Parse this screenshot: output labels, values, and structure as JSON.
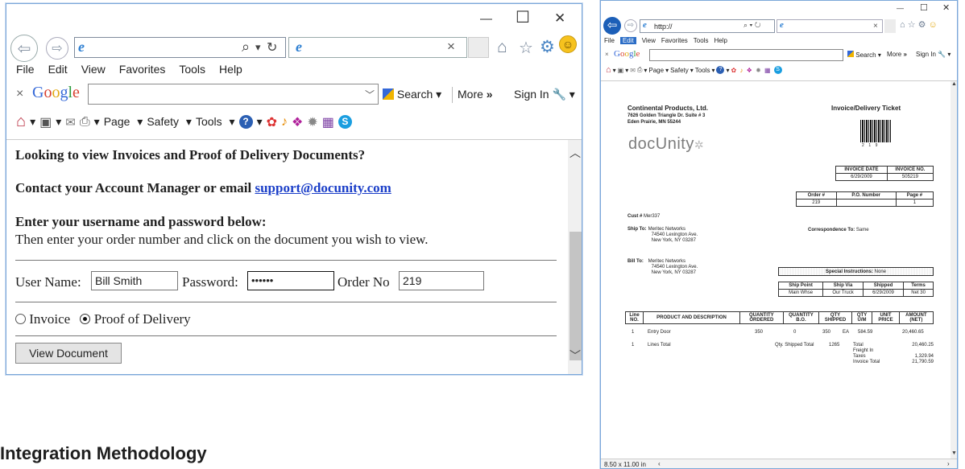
{
  "heading": "Integration Methodology",
  "left_window": {
    "window_controls": {
      "minimize": "—",
      "maximize": "☐",
      "close": "✕"
    },
    "address": {
      "icon": "ie-logo-icon",
      "value": "",
      "search_glyph": "⌕",
      "dropdown": "▾",
      "refresh": "↻"
    },
    "tab_close": "×",
    "menu": [
      "File",
      "Edit",
      "View",
      "Favorites",
      "Tools",
      "Help"
    ],
    "google_bar": {
      "close": "×",
      "logo": [
        "G",
        "o",
        "o",
        "g",
        "l",
        "e"
      ],
      "search_label": "Search",
      "more_label": "More",
      "more_chevrons": "»",
      "signin_label": "Sign In"
    },
    "command_bar": {
      "page_label": "Page",
      "safety_label": "Safety",
      "tools_label": "Tools"
    },
    "content": {
      "line1": "Looking to view Invoices and Proof of Delivery Documents?",
      "line2_text": "Contact your Account Manager or email ",
      "line2_link": "support@docunity.com",
      "line3": "Enter your username and password below:",
      "line4": "Then enter your order number and click on the document you wish to view.",
      "username_label": "User Name:",
      "username_value": "Bill Smith",
      "password_label": "Password:",
      "password_value": "••••••",
      "order_label": "Order No",
      "order_value": "219",
      "radio_invoice": "Invoice",
      "radio_pod": "Proof of Delivery",
      "view_button": "View Document"
    }
  },
  "right_window": {
    "window_controls": {
      "minimize": "—",
      "maximize": "☐",
      "close": "✕"
    },
    "address_value": "http://",
    "menu": [
      "File",
      "Edit",
      "View",
      "Favorites",
      "Tools",
      "Help"
    ],
    "google_bar": {
      "search_label": "Search",
      "more_label": "More",
      "signin_label": "Sign In"
    },
    "command_bar": {
      "page_label": "Page",
      "safety_label": "Safety",
      "tools_label": "Tools"
    },
    "status_size": "8.50 x 11.00 in",
    "invoice": {
      "company": "Continental Products, Ltd.",
      "address1": "7626 Golden Triangle Dr. Suite # 3",
      "address2": "Eden Prairie, MN 55244",
      "title": "Invoice/Delivery Ticket",
      "barcode_caption": "2    1    9",
      "logo_text": "docUnity",
      "invoice_date_label": "INVOICE DATE",
      "invoice_no_label": "INVOICE NO.",
      "invoice_date": "6/29/2009",
      "invoice_no": "505219",
      "order_label": "Order #",
      "po_label": "P.O. Number",
      "page_label": "Page #",
      "order_value": "219",
      "po_value": "",
      "page_value": "1",
      "cust_label": "Cust #",
      "cust_value": "Mer337",
      "ship_to_label": "Ship To:",
      "ship_to": [
        "Meritec Networks",
        "74540 Lexington Ave.",
        "New York, NY 03287"
      ],
      "correspondence_label": "Correspondence To:",
      "correspondence_value": "Same",
      "bill_to_label": "Bill To:",
      "bill_to": [
        "Meritec Networks",
        "74540 Lexington Ave.",
        "New York, NY 03287"
      ],
      "special_label": "Special Instructions:",
      "special_value": "None",
      "ship_headers": [
        "Ship Point",
        "Ship Via",
        "Shipped",
        "Terms"
      ],
      "ship_values": [
        "Main Whse",
        "Our Truck",
        "6/29/2009",
        "Net 30"
      ],
      "item_headers": [
        "Line NO.",
        "PRODUCT AND DESCRIPTION",
        "QUANTITY ORDERED",
        "QUANTITY B.O.",
        "QTY SHIPPED",
        "QTY U/M",
        "UNIT PRICE",
        "AMOUNT (NET)"
      ],
      "item_row": [
        "1",
        "Entry Door",
        "350",
        "0",
        "350",
        "EA",
        "584.59",
        "20,460.65"
      ],
      "total_line_no": "1",
      "total_label": "Lines Total",
      "qty_shipped_total_label": "Qty. Shipped Total",
      "qty_shipped_total": "1265",
      "summary_labels": [
        "Total",
        "Freight In",
        "Taxes",
        "Invoice Total"
      ],
      "summary_values": [
        "20,460.25",
        "",
        "1,329.94",
        "21,790.59"
      ]
    }
  }
}
